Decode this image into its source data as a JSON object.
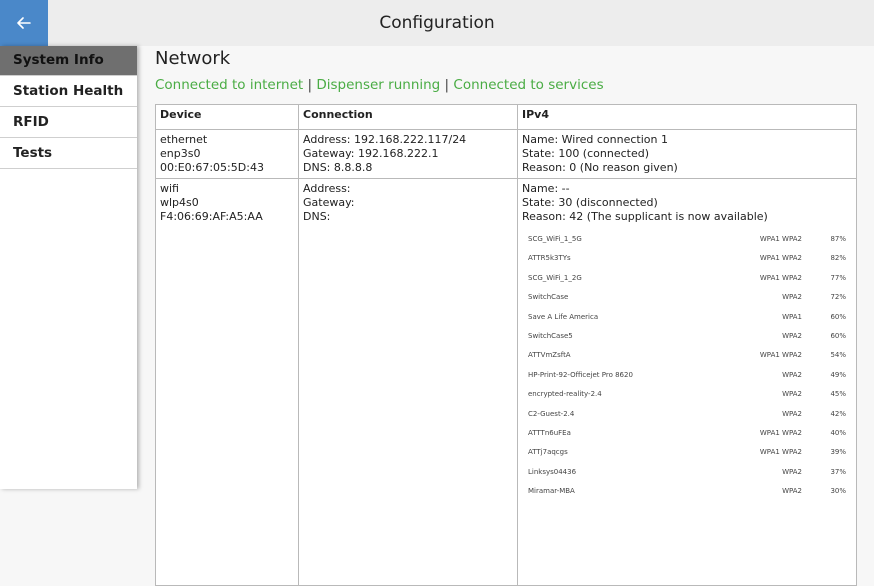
{
  "header": {
    "title": "Configuration"
  },
  "sidebar": {
    "items": [
      {
        "label": "System Info"
      },
      {
        "label": "Station Health"
      },
      {
        "label": "RFID"
      },
      {
        "label": "Tests"
      }
    ]
  },
  "network": {
    "title": "Network",
    "status": {
      "internet": "Connected to internet",
      "dispenser": "Dispenser running",
      "services": "Connected to services",
      "separator": " | "
    },
    "columns": {
      "device": "Device",
      "connection": "Connection",
      "ipv4": "IPv4"
    },
    "rows": [
      {
        "device": [
          "ethernet",
          "enp3s0",
          "00:E0:67:05:5D:43"
        ],
        "connection": [
          "Address: 192.168.222.117/24",
          "Gateway: 192.168.222.1",
          "DNS: 8.8.8.8"
        ],
        "ipv4": [
          "Name: Wired connection 1",
          "State: 100 (connected)",
          "Reason: 0 (No reason given)"
        ]
      },
      {
        "device": [
          "wifi",
          "wlp4s0",
          "F4:06:69:AF:A5:AA"
        ],
        "connection": [
          "Address:",
          "Gateway:",
          "DNS:"
        ],
        "ipv4": [
          "Name: --",
          "State: 30 (disconnected)",
          "Reason: 42 (The supplicant is now available)"
        ]
      }
    ],
    "access_points": [
      {
        "ssid": "SCG_WiFi_1_5G",
        "security": "WPA1 WPA2",
        "signal": "87%"
      },
      {
        "ssid": "ATTR5k3TYs",
        "security": "WPA1 WPA2",
        "signal": "82%"
      },
      {
        "ssid": "SCG_WiFi_1_2G",
        "security": "WPA1 WPA2",
        "signal": "77%"
      },
      {
        "ssid": "SwitchCase",
        "security": "WPA2",
        "signal": "72%"
      },
      {
        "ssid": "Save A Life America",
        "security": "WPA1",
        "signal": "60%"
      },
      {
        "ssid": "SwitchCase5",
        "security": "WPA2",
        "signal": "60%"
      },
      {
        "ssid": "ATTVmZsftA",
        "security": "WPA1 WPA2",
        "signal": "54%"
      },
      {
        "ssid": "HP-Print-92-Officejet Pro 8620",
        "security": "WPA2",
        "signal": "49%"
      },
      {
        "ssid": "encrypted-reality-2.4",
        "security": "WPA2",
        "signal": "45%"
      },
      {
        "ssid": "C2-Guest-2.4",
        "security": "WPA2",
        "signal": "42%"
      },
      {
        "ssid": "ATTTn6uFEa",
        "security": "WPA1 WPA2",
        "signal": "40%"
      },
      {
        "ssid": "ATTj7aqcgs",
        "security": "WPA1 WPA2",
        "signal": "39%"
      },
      {
        "ssid": "Linksys04436",
        "security": "WPA2",
        "signal": "37%"
      },
      {
        "ssid": "Miramar-MBA",
        "security": "WPA2",
        "signal": "30%"
      }
    ]
  },
  "colors": {
    "accent": "#4a88c9",
    "status_green": "#4aac44",
    "active_nav": "#6f6f6f"
  },
  "icons": {
    "back": "arrow-left-icon"
  }
}
